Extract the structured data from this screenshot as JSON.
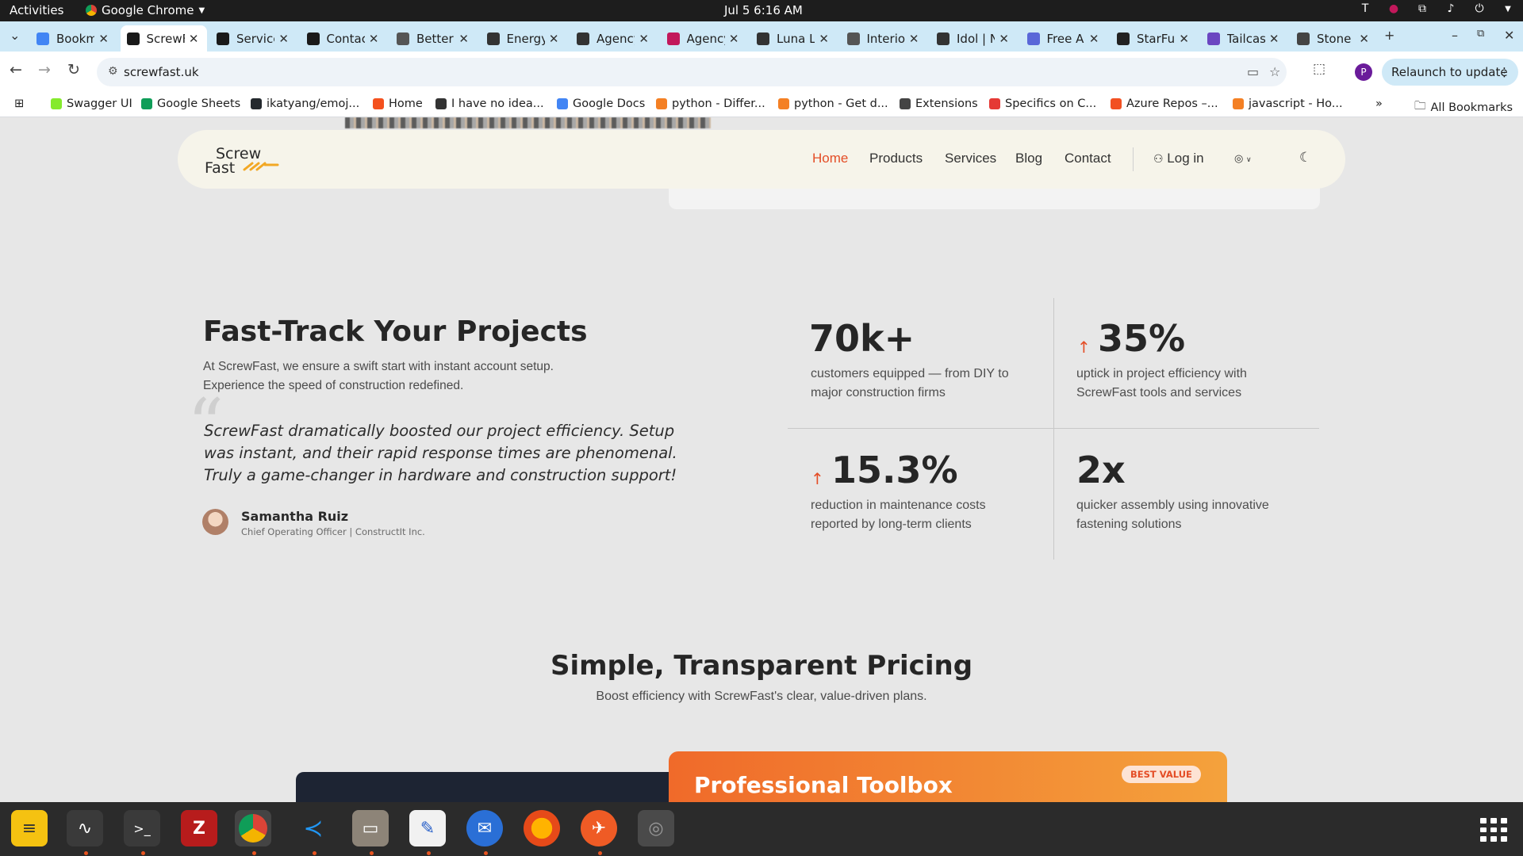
{
  "system": {
    "activities": "Activities",
    "app_name": "Google Chrome",
    "clock": "Jul 5  6:16 AM"
  },
  "tabs": [
    {
      "title": "Bookmarks",
      "color": "#4285f4"
    },
    {
      "title": "ScrewFast",
      "color": "#1a1a1a",
      "active": true
    },
    {
      "title": "Services",
      "color": "#1a1a1a"
    },
    {
      "title": "Contact",
      "color": "#1a1a1a"
    },
    {
      "title": "Better",
      "color": "#555555"
    },
    {
      "title": "Energy",
      "color": "#333333"
    },
    {
      "title": "Agency",
      "color": "#333333"
    },
    {
      "title": "Agency",
      "color": "#c2185b"
    },
    {
      "title": "Luna L",
      "color": "#333333"
    },
    {
      "title": "Interior",
      "color": "#555555"
    },
    {
      "title": "Idol | N",
      "color": "#333333"
    },
    {
      "title": "Free A",
      "color": "#5a67d8"
    },
    {
      "title": "StarFu",
      "color": "#222222"
    },
    {
      "title": "Tailcast",
      "color": "#6b46c1"
    },
    {
      "title": "Stone",
      "color": "#444444"
    }
  ],
  "toolbar": {
    "url": "screwfast.uk",
    "relaunch": "Relaunch to update",
    "profile_initial": "P"
  },
  "bookmarks": [
    {
      "label": "Swagger UI",
      "color": "#85ea2d"
    },
    {
      "label": "Google Sheets",
      "color": "#0f9d58"
    },
    {
      "label": "ikatyang/emoj...",
      "color": "#24292e"
    },
    {
      "label": "Home",
      "color": "#f4511e"
    },
    {
      "label": "I have no idea...",
      "color": "#333333"
    },
    {
      "label": "Google Docs",
      "color": "#4285f4"
    },
    {
      "label": "python - Differ...",
      "color": "#f48024"
    },
    {
      "label": "python - Get d...",
      "color": "#f48024"
    },
    {
      "label": "Extensions",
      "color": "#444444"
    },
    {
      "label": "Specifics on C...",
      "color": "#e53935"
    },
    {
      "label": "Azure Repos –...",
      "color": "#f25022"
    },
    {
      "label": "javascript - Ho...",
      "color": "#f48024"
    }
  ],
  "all_bookmarks": "All Bookmarks",
  "site": {
    "logo_line1": "Screw",
    "logo_line2": "Fast",
    "nav": {
      "home": "Home",
      "products": "Products",
      "services": "Services",
      "blog": "Blog",
      "contact": "Contact",
      "login": "Log in"
    },
    "accent": "#e44d26",
    "fast": {
      "title": "Fast-Track Your Projects",
      "desc1": "At ScrewFast, we ensure a swift start with instant account setup.",
      "desc2": "Experience the speed of construction redefined.",
      "quote1": "ScrewFast dramatically boosted our project efficiency. Setup",
      "quote2": "was instant, and their rapid response times are phenomenal.",
      "quote3": "Truly a game-changer in hardware and construction support!",
      "author": "Samantha Ruiz",
      "role": "Chief Operating Officer | ConstructIt Inc."
    },
    "stats": [
      {
        "value": "70k+",
        "line1": "customers equipped — from DIY to",
        "line2": "major construction firms"
      },
      {
        "value": "35%",
        "line1": "uptick in project efficiency with",
        "line2": "ScrewFast tools and services"
      },
      {
        "value": "15.3%",
        "line1": "reduction in maintenance costs",
        "line2": "reported by long-term clients"
      },
      {
        "value": "2x",
        "line1": "quicker assembly using innovative",
        "line2": "fastening solutions"
      }
    ],
    "pricing": {
      "title": "Simple, Transparent Pricing",
      "subtitle": "Boost efficiency with ScrewFast's clear, value-driven plans.",
      "card_title": "Professional Toolbox",
      "badge": "BEST VALUE"
    }
  }
}
